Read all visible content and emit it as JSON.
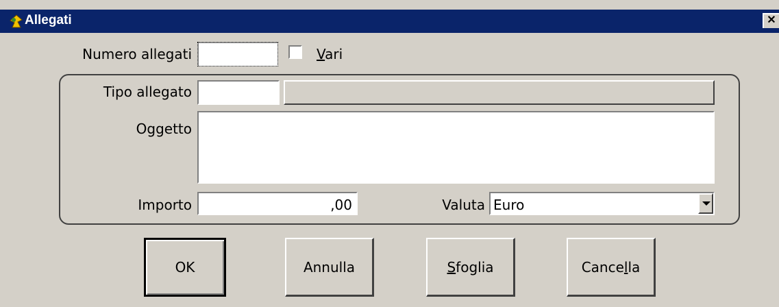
{
  "window": {
    "title": "Allegati",
    "close_label": "✕"
  },
  "form": {
    "numero_allegati_label": "Numero allegati",
    "numero_allegati_value": "",
    "vari_label_first": "V",
    "vari_label_rest": "ari",
    "vari_checked": false,
    "tipo_allegato_label": "Tipo allegato",
    "tipo_allegato_value": "",
    "tipo_allegato_description": "",
    "oggetto_label": "Oggetto",
    "oggetto_value": "",
    "importo_label": "Importo",
    "importo_value": ",00",
    "valuta_label": "Valuta",
    "valuta_value": "Euro"
  },
  "buttons": {
    "ok": "OK",
    "annulla": "Annulla",
    "sfoglia_first": "S",
    "sfoglia_rest": "foglia",
    "cancella_pre": "Cance",
    "cancella_ul": "l",
    "cancella_post": "la"
  }
}
